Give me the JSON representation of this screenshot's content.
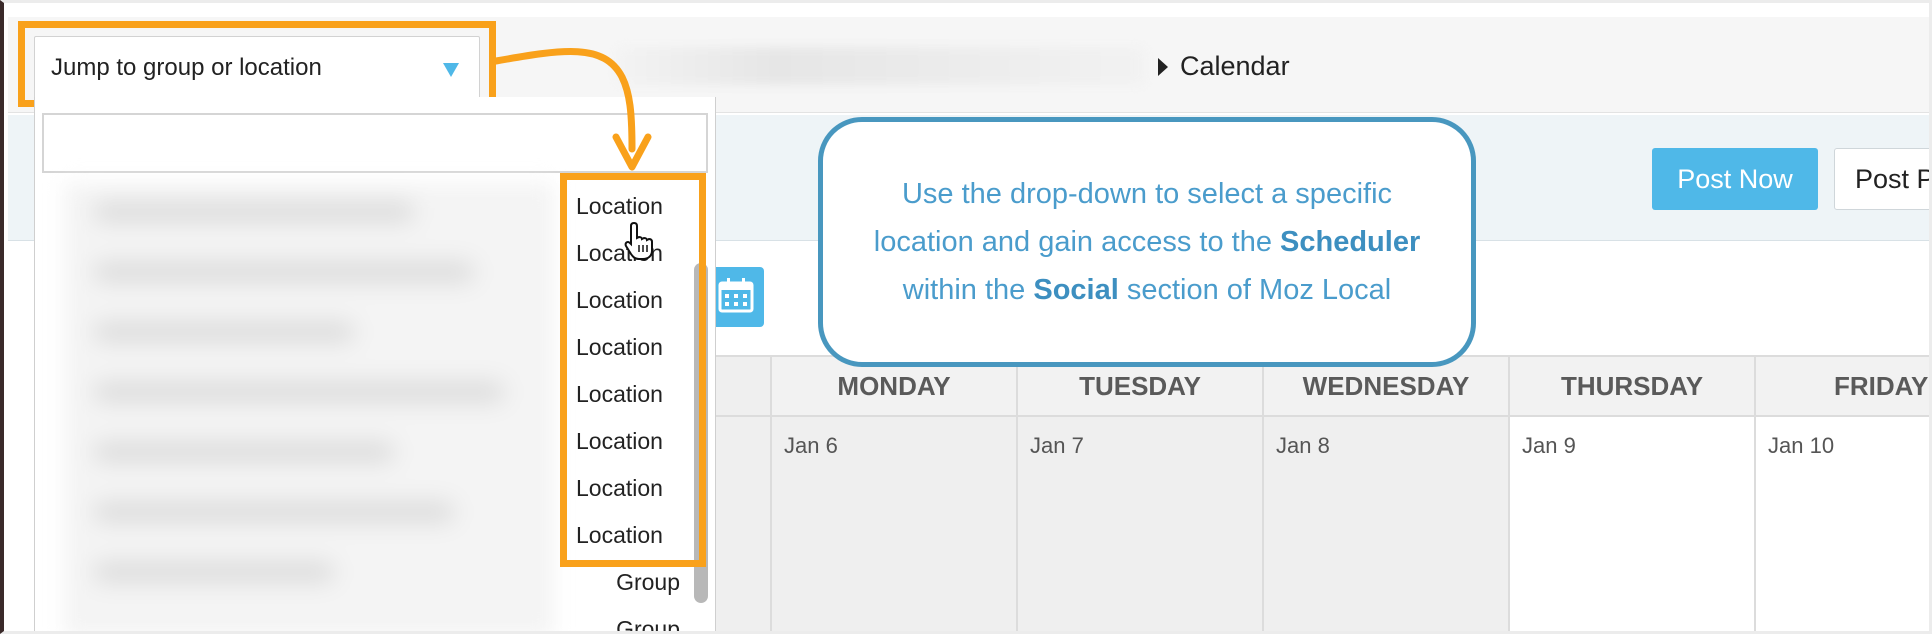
{
  "header": {
    "jump_select_label": "Jump to group or location",
    "breadcrumb_label": "Calendar"
  },
  "toolbar": {
    "post_now_label": "Post Now",
    "post_later_label": "Post P"
  },
  "dropdown": {
    "search_placeholder": "",
    "items": [
      {
        "label": "Location"
      },
      {
        "label": "Location"
      },
      {
        "label": "Location"
      },
      {
        "label": "Location"
      },
      {
        "label": "Location"
      },
      {
        "label": "Location"
      },
      {
        "label": "Location"
      },
      {
        "label": "Location"
      },
      {
        "label": "Group"
      },
      {
        "label": "Group"
      }
    ]
  },
  "callout": {
    "line1": "Use the drop-down to select a specific",
    "line2_prefix": "location and gain access to the ",
    "line2_bold": "Scheduler",
    "line3_prefix": "within the ",
    "line3_bold": "Social",
    "line3_suffix": " section of Moz Local"
  },
  "calendar": {
    "days": [
      {
        "name": "MONDAY",
        "date": "Jan 6"
      },
      {
        "name": "TUESDAY",
        "date": "Jan 7"
      },
      {
        "name": "WEDNESDAY",
        "date": "Jan 8"
      },
      {
        "name": "THURSDAY",
        "date": "Jan 9"
      },
      {
        "name": "FRIDAY",
        "date": "Jan 10"
      }
    ]
  },
  "colors": {
    "accent": "#4fb8e8",
    "highlight": "#f9a11b",
    "callout_border": "#4897bf",
    "callout_text": "#4a9ccc"
  }
}
